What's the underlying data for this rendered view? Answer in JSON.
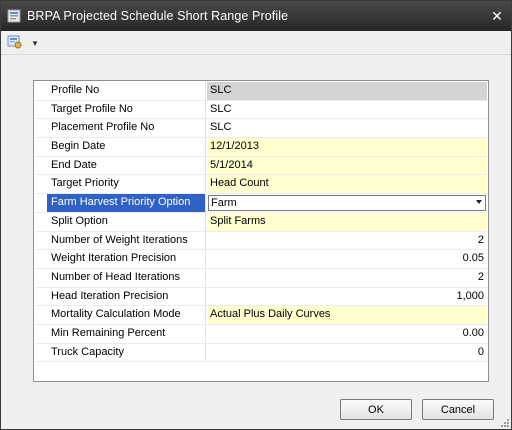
{
  "window": {
    "title": "BRPA Projected Schedule Short Range Profile",
    "close_glyph": "✕"
  },
  "toolbar": {
    "dropdown_glyph": "▼"
  },
  "fields": [
    {
      "label": "Profile No",
      "value": "SLC",
      "style": "grey"
    },
    {
      "label": "Target Profile No",
      "value": "SLC",
      "style": "plain"
    },
    {
      "label": "Placement Profile No",
      "value": "SLC",
      "style": "plain"
    },
    {
      "label": "Begin Date",
      "value": "12/1/2013",
      "style": "yellow"
    },
    {
      "label": "End Date",
      "value": "5/1/2014",
      "style": "yellow"
    },
    {
      "label": "Target Priority",
      "value": "Head Count",
      "style": "yellow"
    },
    {
      "label": "Farm Harvest Priority Option",
      "value": "Farm",
      "style": "combo"
    },
    {
      "label": "Split Option",
      "value": "Split Farms",
      "style": "yellow"
    },
    {
      "label": "Number of Weight Iterations",
      "value": "2",
      "style": "num"
    },
    {
      "label": "Weight Iteration Precision",
      "value": "0.05",
      "style": "num"
    },
    {
      "label": "Number of Head Iterations",
      "value": "2",
      "style": "num"
    },
    {
      "label": "Head Iteration Precision",
      "value": "1,000",
      "style": "num"
    },
    {
      "label": "Mortality Calculation Mode",
      "value": "Actual Plus Daily Curves",
      "style": "yellow"
    },
    {
      "label": "Min Remaining Percent",
      "value": "0.00",
      "style": "num"
    },
    {
      "label": "Truck Capacity",
      "value": "0",
      "style": "num"
    }
  ],
  "buttons": {
    "ok": "OK",
    "cancel": "Cancel"
  },
  "colors": {
    "selected_label_bg": "#2f62c4",
    "required_bg": "#ffffd0",
    "readonly_bg": "#d4d4d4"
  }
}
